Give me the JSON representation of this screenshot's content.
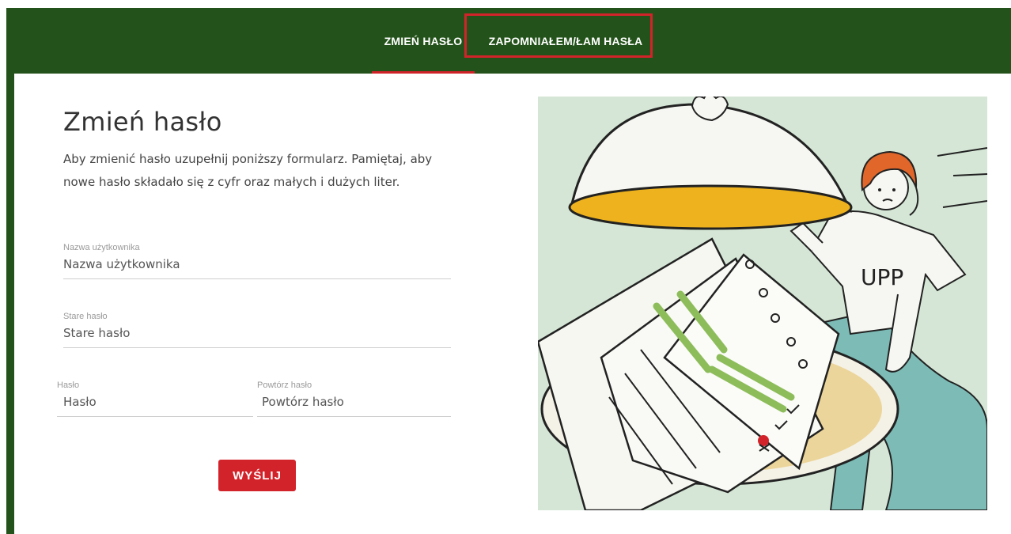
{
  "nav": {
    "tabs": [
      {
        "label": "ZMIEŃ HASŁO",
        "active": true
      },
      {
        "label": "ZAPOMNIAŁEM/ŁAM HASŁA",
        "active": false
      }
    ]
  },
  "form": {
    "title": "Zmień hasło",
    "intro": "Aby zmienić hasło uzupełnij poniższy formularz. Pamiętaj, aby nowe hasło składało się z cyfr oraz małych i dużych liter.",
    "username": {
      "label": "Nazwa użytkownika",
      "placeholder": "Nazwa użytkownika",
      "value": ""
    },
    "old_password": {
      "label": "Stare hasło",
      "placeholder": "Stare hasło",
      "value": ""
    },
    "new_password": {
      "label": "Hasło",
      "placeholder": "Hasło",
      "value": ""
    },
    "repeat_password": {
      "label": "Powtórz hasło",
      "placeholder": "Powtórz hasło",
      "value": ""
    },
    "submit_label": "WYŚLIJ"
  },
  "illustration": {
    "shirt_text": "UPP"
  },
  "colors": {
    "header_green": "#23531a",
    "accent_red": "#d3232a",
    "illustration_bg": "#d5e6d6"
  }
}
